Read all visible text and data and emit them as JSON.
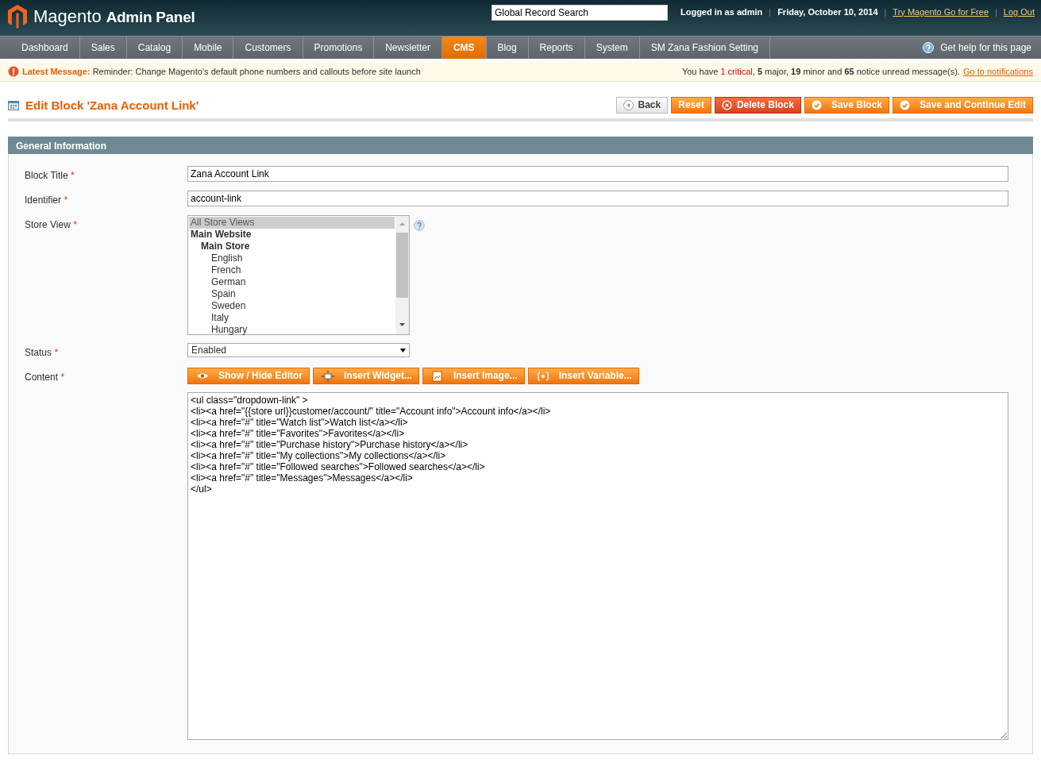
{
  "header": {
    "logo_brand": "Magento",
    "logo_suffix": "Admin Panel",
    "search": {
      "value": "Global Record Search"
    },
    "user_info": "Logged in as admin",
    "date": "Friday, October 10, 2014",
    "links": [
      "Try Magento Go for Free",
      "Log Out"
    ],
    "separator": "|"
  },
  "nav": {
    "items": [
      {
        "label": "Dashboard",
        "selected": false
      },
      {
        "label": "Sales",
        "selected": false
      },
      {
        "label": "Catalog",
        "selected": false
      },
      {
        "label": "Mobile",
        "selected": false
      },
      {
        "label": "Customers",
        "selected": false
      },
      {
        "label": "Promotions",
        "selected": false
      },
      {
        "label": "Newsletter",
        "selected": false
      },
      {
        "label": "CMS",
        "selected": true
      },
      {
        "label": "Blog",
        "selected": false
      },
      {
        "label": "Reports",
        "selected": false
      },
      {
        "label": "System",
        "selected": false
      },
      {
        "label": "SM Zana Fashion Setting",
        "selected": false
      }
    ],
    "help": "Get help for this page"
  },
  "message_bar": {
    "label": "Latest Message:",
    "text": "Reminder: Change Magento’s default phone numbers and callouts before site launch",
    "summary": [
      {
        "kind": "plain",
        "text": "You have "
      },
      {
        "kind": "critical",
        "text": "1 critical"
      },
      {
        "kind": "plain",
        "text": ", "
      },
      {
        "kind": "bold",
        "text": "5"
      },
      {
        "kind": "plain",
        "text": " major, "
      },
      {
        "kind": "bold",
        "text": "19"
      },
      {
        "kind": "plain",
        "text": " minor and "
      },
      {
        "kind": "bold",
        "text": "65"
      },
      {
        "kind": "plain",
        "text": " notice unread message(s)."
      }
    ],
    "link": "Go to notifications"
  },
  "page": {
    "title": "Edit Block 'Zana Account Link'",
    "buttons": [
      {
        "label": "Back",
        "kind": "back"
      },
      {
        "label": "Reset",
        "kind": "plain"
      },
      {
        "label": "Delete Block",
        "kind": "delete"
      },
      {
        "label": "Save Block",
        "kind": "save"
      },
      {
        "label": "Save and Continue Edit",
        "kind": "save"
      }
    ]
  },
  "section": {
    "title": "General Information",
    "required_mark": "*",
    "fields": [
      {
        "kind": "text",
        "label": "Block Title",
        "required": true,
        "value": "Zana Account Link"
      },
      {
        "kind": "text",
        "label": "Identifier",
        "required": true,
        "value": "account-link"
      },
      {
        "kind": "multiselect",
        "label": "Store View",
        "required": true,
        "options": [
          {
            "kind": "option",
            "label": "All Store Views",
            "selected": true
          },
          {
            "kind": "group",
            "label": "Main Website",
            "children": [
              {
                "kind": "group",
                "label": "Main Store",
                "children": [
                  {
                    "kind": "option",
                    "label": "English",
                    "selected": false
                  },
                  {
                    "kind": "option",
                    "label": "French",
                    "selected": false
                  },
                  {
                    "kind": "option",
                    "label": "German",
                    "selected": false
                  },
                  {
                    "kind": "option",
                    "label": "Spain",
                    "selected": false
                  },
                  {
                    "kind": "option",
                    "label": "Sweden",
                    "selected": false
                  },
                  {
                    "kind": "option",
                    "label": "Italy",
                    "selected": false
                  },
                  {
                    "kind": "option",
                    "label": "Hungary",
                    "selected": false
                  }
                ]
              }
            ]
          }
        ]
      },
      {
        "kind": "select",
        "label": "Status",
        "required": true,
        "value": "Enabled"
      },
      {
        "kind": "editor",
        "label": "Content",
        "required": true,
        "buttons": [
          {
            "label": "Show / Hide Editor"
          },
          {
            "label": "Insert Widget..."
          },
          {
            "label": "Insert Image..."
          },
          {
            "label": "Insert Variable..."
          }
        ],
        "value": "<ul class=\"dropdown-link\" >\n<li><a href=\"{{store url}}customer/account/\" title=\"Account info\">Account info</a></li>\n<li><a href=\"#\" title=\"Watch list\">Watch list</a></li>\n<li><a href=\"#\" title=\"Favorites\">Favorites</a></li>\n<li><a href=\"#\" title=\"Purchase history\">Purchase history</a></li>\n<li><a href=\"#\" title=\"My collections\">My collections</a></li>\n<li><a href=\"#\" title=\"Followed searches\">Followed searches</a></li>\n<li><a href=\"#\" title=\"Messages\">Messages</a></li>\n</ul>"
      }
    ]
  }
}
